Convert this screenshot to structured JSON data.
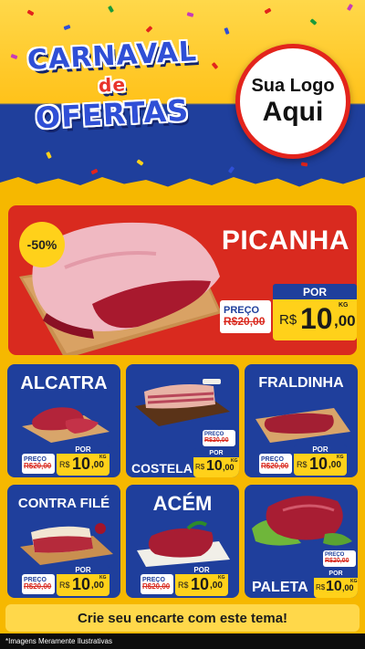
{
  "header": {
    "title_line1": "CARNAVAL",
    "title_line2": "de",
    "title_line3": "OFERTAS",
    "logo_line1": "Sua Logo",
    "logo_line2": "Aqui"
  },
  "featured": {
    "discount": "-50%",
    "name": "PICANHA",
    "preco_label": "PREÇO",
    "old_price": "R$20,00",
    "por_label": "POR",
    "currency": "R$",
    "price_int": "10",
    "price_cents": ",00",
    "unit": "KG"
  },
  "products": [
    {
      "name": "ALCATRA",
      "preco_label": "PREÇO",
      "old_price": "R$20,00",
      "por_label": "POR",
      "currency": "R$",
      "price_int": "10",
      "price_cents": ",00",
      "unit": "KG"
    },
    {
      "name": "COSTELA",
      "preco_label": "PREÇO",
      "old_price": "R$20,00",
      "por_label": "POR",
      "currency": "R$",
      "price_int": "10",
      "price_cents": ",00",
      "unit": "KG"
    },
    {
      "name": "FRALDINHA",
      "preco_label": "PREÇO",
      "old_price": "R$20,00",
      "por_label": "POR",
      "currency": "R$",
      "price_int": "10",
      "price_cents": ",00",
      "unit": "KG"
    },
    {
      "name": "CONTRA FILÉ",
      "preco_label": "PREÇO",
      "old_price": "R$20,00",
      "por_label": "POR",
      "currency": "R$",
      "price_int": "10",
      "price_cents": ",00",
      "unit": "KG"
    },
    {
      "name": "ACÉM",
      "preco_label": "PREÇO",
      "old_price": "R$20,00",
      "por_label": "POR",
      "currency": "R$",
      "price_int": "10",
      "price_cents": ",00",
      "unit": "KG"
    },
    {
      "name": "PALETA",
      "preco_label": "PREÇO",
      "old_price": "R$20,00",
      "por_label": "POR",
      "currency": "R$",
      "price_int": "10",
      "price_cents": ",00",
      "unit": "KG"
    }
  ],
  "footer": {
    "cta": "Crie seu encarte com este tema!",
    "disclaimer": "*Imagens Meramente Ilustrativas"
  },
  "colors": {
    "background": "#f6b800",
    "blue": "#1f3f9c",
    "red": "#d92a1f",
    "yellow": "#ffd11a"
  },
  "icons": [
    "picanha-image",
    "alcatra-image",
    "costela-image",
    "fraldinha-image",
    "contra-file-image",
    "acem-image",
    "paleta-image"
  ]
}
